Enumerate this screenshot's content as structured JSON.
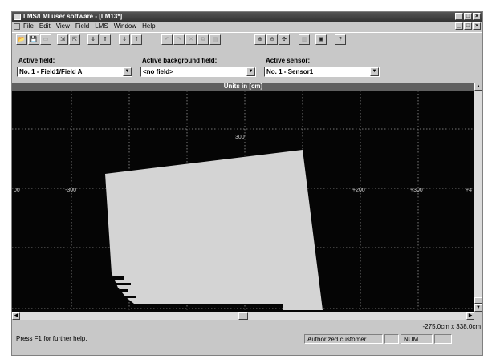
{
  "app": {
    "title": "LMS/LMI user software - [LM13*]",
    "window_buttons": [
      "_",
      "□",
      "×"
    ],
    "mdi_buttons": [
      "_",
      "□",
      "×"
    ]
  },
  "menu": {
    "items": [
      "File",
      "Edit",
      "View",
      "Field",
      "LMS",
      "Window",
      "Help"
    ]
  },
  "toolbar": {
    "buttons": [
      {
        "icon": "open-icon",
        "glyph": "📂"
      },
      {
        "icon": "save-icon",
        "glyph": "💾"
      },
      {
        "icon": "print-icon",
        "glyph": "▭",
        "disabled": true
      },
      {
        "icon": "field-import-icon",
        "glyph": "⇲"
      },
      {
        "icon": "field-export-icon",
        "glyph": "⇱"
      },
      {
        "icon": "sensor-read-icon",
        "glyph": "⇓"
      },
      {
        "icon": "sensor-write-icon",
        "glyph": "⇑"
      },
      {
        "icon": "field-read-icon",
        "glyph": "⇓"
      },
      {
        "icon": "field-write-icon",
        "glyph": "⇑"
      },
      {
        "icon": "undo-icon",
        "glyph": "↶",
        "disabled": true
      },
      {
        "icon": "redo-icon",
        "glyph": "↷",
        "disabled": true
      },
      {
        "icon": "cut-icon",
        "glyph": "✕",
        "disabled": true
      },
      {
        "icon": "copy-icon",
        "glyph": "⧉",
        "disabled": true
      },
      {
        "icon": "paste-icon",
        "glyph": "▤",
        "disabled": true
      },
      {
        "icon": "zoom-in-icon",
        "glyph": "⊕"
      },
      {
        "icon": "zoom-out-icon",
        "glyph": "⊖"
      },
      {
        "icon": "zoom-fit-icon",
        "glyph": "✣"
      },
      {
        "icon": "teach-icon",
        "glyph": "▥",
        "disabled": true
      },
      {
        "icon": "monitor-icon",
        "glyph": "▣"
      },
      {
        "icon": "context-help-icon",
        "glyph": "?"
      }
    ]
  },
  "fields": {
    "active_field": {
      "label": "Active field:",
      "value": "No. 1 - Field1/Field A"
    },
    "active_background": {
      "label": "Active background field:",
      "value": "<no field>"
    },
    "active_sensor": {
      "label": "Active sensor:",
      "value": "No. 1 - Sensor1"
    }
  },
  "plot": {
    "units_title": "Units in [cm]",
    "x_tick_labels": [
      "00",
      "-300",
      "+200",
      "+300",
      "+4"
    ],
    "y_tick_labels": [
      "300"
    ],
    "colors": {
      "background": "#050505",
      "field": "#d4d4d4",
      "grid": "#9a9a9a"
    }
  },
  "coordinates": {
    "readout": "-275.0cm x 338.0cm"
  },
  "status": {
    "help": "Press F1 for further help.",
    "user": "Authorized customer",
    "num": "NUM"
  }
}
